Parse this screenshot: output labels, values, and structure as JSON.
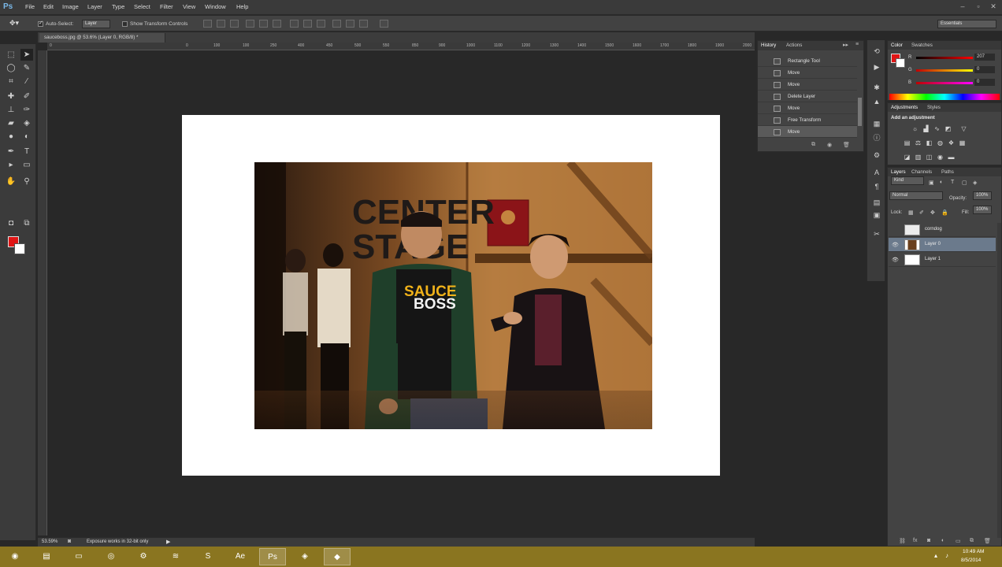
{
  "app": {
    "logo": "Ps",
    "workspace": "Essentials"
  },
  "menu": [
    "File",
    "Edit",
    "Image",
    "Layer",
    "Type",
    "Select",
    "Filter",
    "View",
    "Window",
    "Help"
  ],
  "options_bar": {
    "auto_select_label": "Auto-Select:",
    "auto_select_value": "Layer",
    "show_transform_label": "Show Transform Controls"
  },
  "document": {
    "tab_title": "sauceboss.jpg @ 53.6% (Layer 0, RGB/8) *",
    "ruler_ticks": [
      "0",
      "50",
      "100",
      "200",
      "250",
      "300",
      "400",
      "450",
      "500",
      "550",
      "600",
      "650",
      "700",
      "800",
      "850",
      "900",
      "1000",
      "1100",
      "1200",
      "1300",
      "1400",
      "1500",
      "1600",
      "1700",
      "1800",
      "1900",
      "2000"
    ],
    "photo_text": {
      "sign_line1": "CENTER",
      "sign_line2": "STAGE",
      "shirt_line1": "SAUCE",
      "shirt_line2": "BOSS"
    }
  },
  "status": {
    "zoom": "53.59%",
    "message": "Exposure works in 32-bit only"
  },
  "history": {
    "tabs": [
      "History",
      "Actions"
    ],
    "items": [
      "Rectangle Tool",
      "Move",
      "Move",
      "Delete Layer",
      "Move",
      "Free Transform",
      "Move"
    ],
    "selected_index": 6
  },
  "color": {
    "tabs": [
      "Color",
      "Swatches"
    ],
    "channels": [
      {
        "label": "R",
        "value": "207"
      },
      {
        "label": "G",
        "value": "0"
      },
      {
        "label": "B",
        "value": "0"
      }
    ],
    "foreground": "#e01515",
    "background": "#ffffff"
  },
  "adjustments": {
    "tabs": [
      "Adjustments",
      "Styles"
    ],
    "title": "Add an adjustment"
  },
  "layers": {
    "tabs": [
      "Layers",
      "Channels",
      "Paths"
    ],
    "filter": "Kind",
    "blend_mode": "Normal",
    "opacity_label": "Opacity:",
    "opacity": "100%",
    "lock_label": "Lock:",
    "fill_label": "Fill:",
    "fill": "100%",
    "items": [
      {
        "name": "corndog",
        "visible": false,
        "selected": false
      },
      {
        "name": "Layer 0",
        "visible": true,
        "selected": true
      },
      {
        "name": "Layer 1",
        "visible": true,
        "selected": false
      }
    ]
  },
  "taskbar": {
    "apps": [
      "windows-start",
      "file-manager",
      "folder",
      "chrome",
      "steam",
      "spotify",
      "skype",
      "after-effects",
      "photoshop",
      "unknown-app-1",
      "unknown-app-2"
    ],
    "time": "10:49 AM",
    "date": "8/5/2014"
  }
}
